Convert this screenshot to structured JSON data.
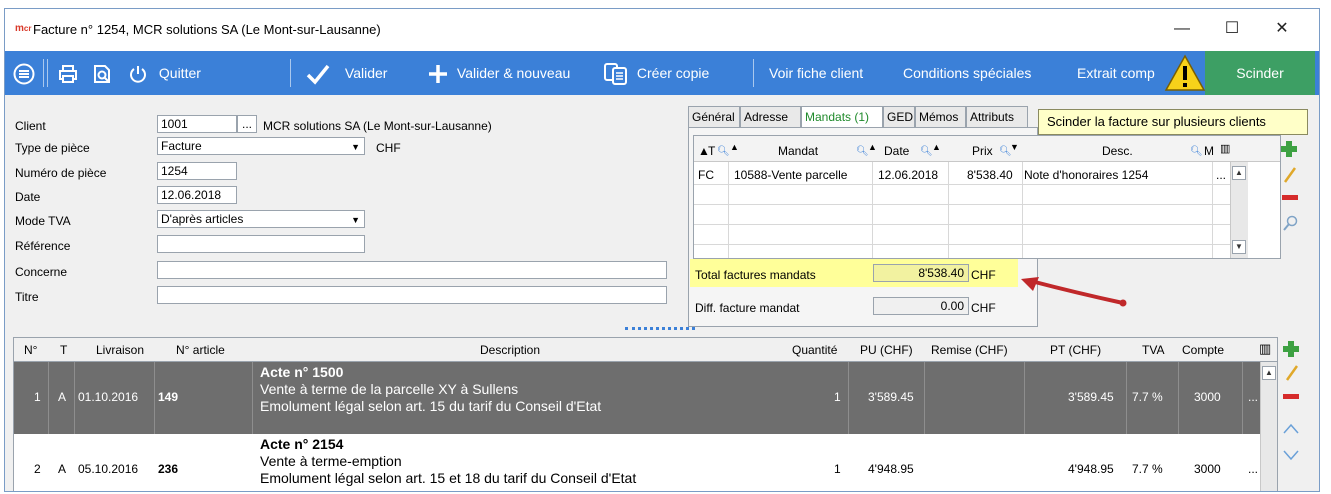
{
  "window": {
    "logo": "m",
    "title": "Facture n° 1254, MCR solutions SA (Le Mont-sur-Lausanne)",
    "minimize": "—",
    "maximize": "☐",
    "close": "✕"
  },
  "toolbar": {
    "quit_label": "Quitter",
    "validate_label": "Valider",
    "validate_new_label": "Valider & nouveau",
    "copy_label": "Créer copie",
    "client_sheet_label": "Voir fiche client",
    "special_conditions_label": "Conditions spéciales",
    "extract_label": "Extrait comp",
    "split_label": "Scinder",
    "tooltip": "Scinder la facture sur plusieurs clients"
  },
  "form": {
    "client_label": "Client",
    "client_code": "1001",
    "client_browse": "...",
    "client_name": "MCR solutions SA (Le Mont-sur-Lausanne)",
    "doc_type_label": "Type de pièce",
    "doc_type_value": "Facture",
    "currency": "CHF",
    "doc_number_label": "Numéro de pièce",
    "doc_number_value": "1254",
    "date_label": "Date",
    "date_value": "12.06.2018",
    "vat_mode_label": "Mode TVA",
    "vat_mode_value": "D'après articles",
    "reference_label": "Référence",
    "reference_value": "",
    "concerne_label": "Concerne",
    "concerne_value": "",
    "title_label": "Titre",
    "title_value": ""
  },
  "tabs": [
    {
      "label": "Général"
    },
    {
      "label": "Adresse"
    },
    {
      "label": "Mandats (1)"
    },
    {
      "label": "GED"
    },
    {
      "label": "Mémos"
    },
    {
      "label": "Attributs"
    }
  ],
  "mandates": {
    "headers": {
      "t": "T",
      "mandat": "Mandat",
      "date": "Date",
      "prix": "Prix",
      "desc": "Desc.",
      "m": "M"
    },
    "rows": [
      {
        "t": "FC",
        "mandat": "10588-Vente parcelle",
        "date": "12.06.2018",
        "prix": "8'538.40",
        "desc": "Note d'honoraires 1254",
        "more": "..."
      }
    ],
    "total_label": "Total factures mandats",
    "total_value": "8'538.40",
    "total_currency": "CHF",
    "diff_label": "Diff. facture mandat",
    "diff_value": "0.00",
    "diff_currency": "CHF"
  },
  "lines": {
    "headers": {
      "no": "N°",
      "t": "T",
      "livraison": "Livraison",
      "article": "N° article",
      "description": "Description",
      "quantite": "Quantité",
      "pu": "PU (CHF)",
      "remise": "Remise (CHF)",
      "pt": "PT (CHF)",
      "tva": "TVA",
      "compte": "Compte"
    },
    "rows": [
      {
        "no": "1",
        "t": "A",
        "livraison": "01.10.2016",
        "article": "149",
        "desc_title": "Acte n° 1500",
        "desc_line1": "Vente à terme de la parcelle XY à Sullens",
        "desc_line2": "Emolument légal selon art. 15 du tarif du Conseil d'Etat",
        "quantite": "1",
        "pu": "3'589.45",
        "remise": "",
        "pt": "3'589.45",
        "tva": "7.7 %",
        "compte": "3000",
        "more": "..."
      },
      {
        "no": "2",
        "t": "A",
        "livraison": "05.10.2016",
        "article": "236",
        "desc_title": "Acte n° 2154",
        "desc_line1": "Vente à terme-emption",
        "desc_line2": "Emolument légal selon art. 15 et 18 du tarif du Conseil d'Etat",
        "quantite": "1",
        "pu": "4'948.95",
        "remise": "",
        "pt": "4'948.95",
        "tva": "7.7 %",
        "compte": "3000",
        "more": "..."
      }
    ]
  },
  "colors": {
    "toolbar": "#3b80d8",
    "split_button": "#3d9f64",
    "selected_row": "#6e6e6e",
    "highlight": "#ffff99",
    "arrow": "#c0282a"
  }
}
